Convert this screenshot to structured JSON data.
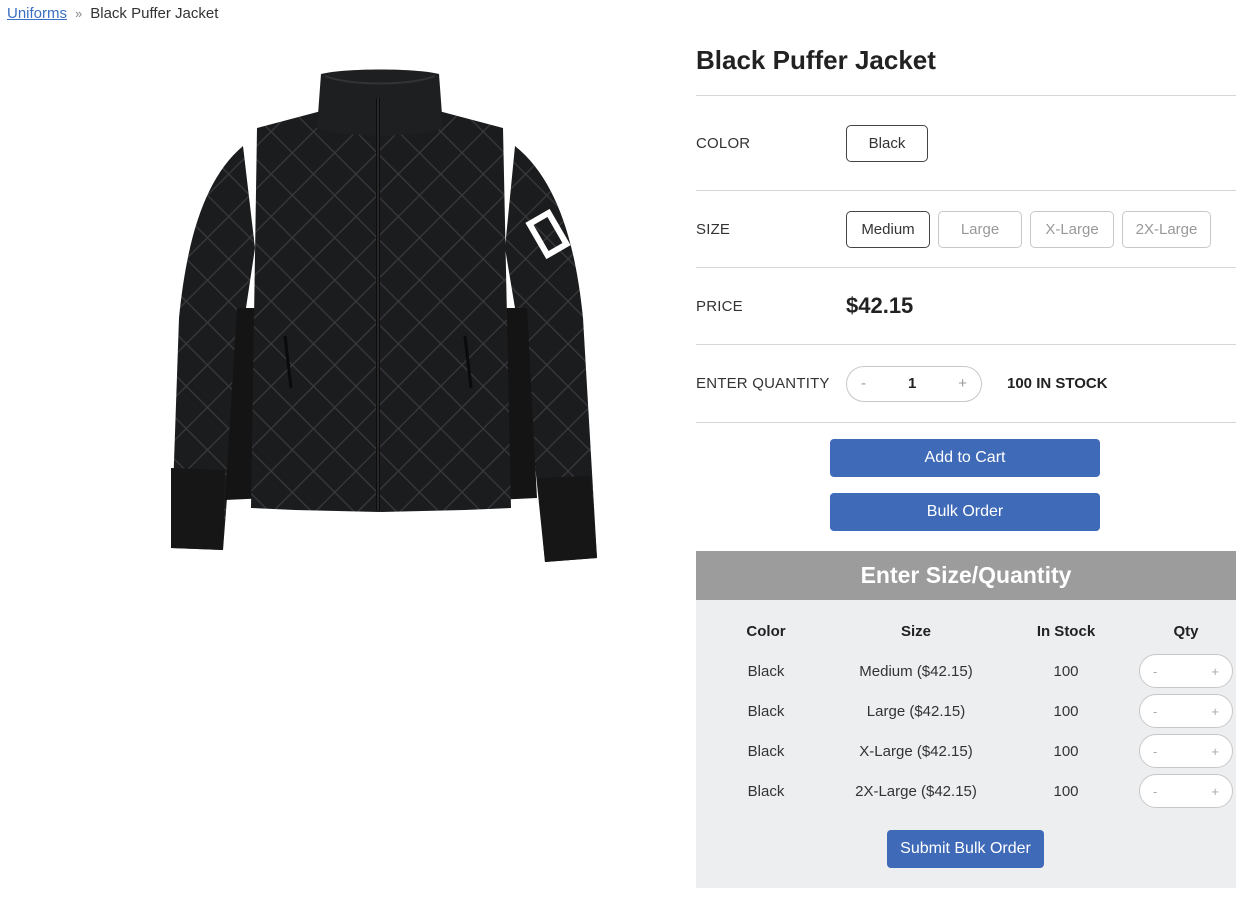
{
  "breadcrumb": {
    "parent": "Uniforms",
    "separator": "»",
    "current": "Black Puffer Jacket"
  },
  "product": {
    "title": "Black Puffer Jacket",
    "image_icon": "black-quilted-jacket-image",
    "color": {
      "label": "COLOR",
      "options": [
        "Black"
      ],
      "selected": "Black"
    },
    "size": {
      "label": "SIZE",
      "options": [
        "Medium",
        "Large",
        "X-Large",
        "2X-Large"
      ],
      "selected": "Medium"
    },
    "price": {
      "label": "PRICE",
      "value": "$42.15"
    },
    "quantity": {
      "label": "ENTER QUANTITY",
      "minus": "-",
      "value": "1",
      "plus": "+",
      "stock": "100 IN STOCK"
    },
    "add_to_cart": "Add to Cart",
    "bulk_order": "Bulk Order"
  },
  "bulk": {
    "header": "Enter Size/Quantity",
    "columns": [
      "Color",
      "Size",
      "In Stock",
      "Qty"
    ],
    "rows": [
      {
        "color": "Black",
        "size": "Medium ($42.15)",
        "stock": "100"
      },
      {
        "color": "Black",
        "size": "Large ($42.15)",
        "stock": "100"
      },
      {
        "color": "Black",
        "size": "X-Large ($42.15)",
        "stock": "100"
      },
      {
        "color": "Black",
        "size": "2X-Large ($42.15)",
        "stock": "100"
      }
    ],
    "stepper": {
      "minus": "-",
      "plus": "+"
    },
    "submit": "Submit Bulk Order"
  },
  "colors": {
    "accent": "#3e6ab8",
    "panel_header": "#9c9c9c",
    "panel_bg": "#eceef0",
    "link": "#3a6fc4"
  }
}
